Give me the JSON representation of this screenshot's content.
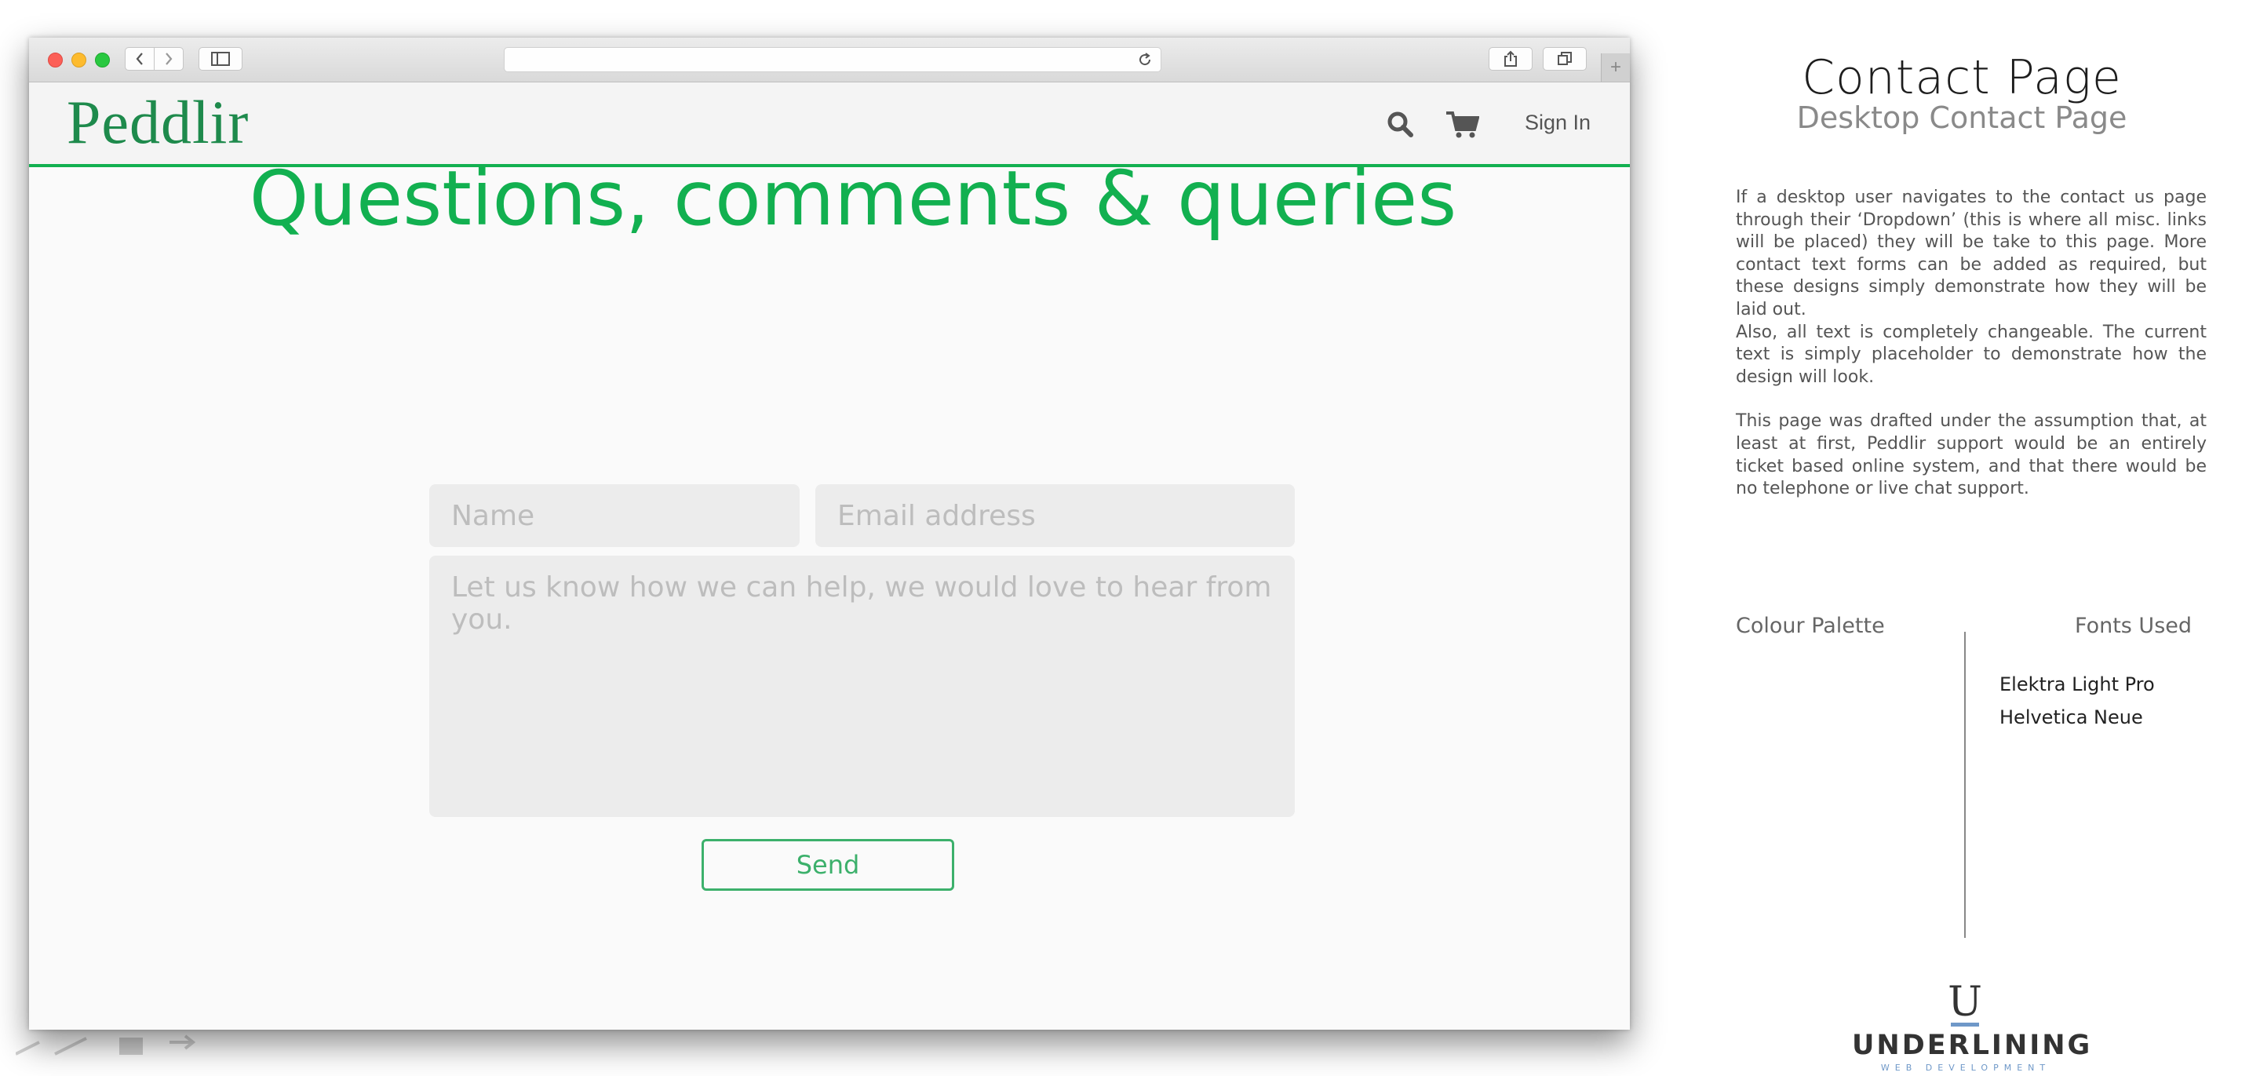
{
  "browser": {
    "nav": {
      "back_icon": "chevron-left-icon",
      "forward_icon": "chevron-right-icon"
    },
    "new_tab_label": "+"
  },
  "site": {
    "logo": "Peddlir",
    "sign_in": "Sign In",
    "brand_color": "#12b050",
    "icons": [
      "search-icon",
      "cart-icon"
    ]
  },
  "contact": {
    "headline": "Questions, comments & queries",
    "name_placeholder": "Name",
    "email_placeholder": "Email address",
    "message_placeholder": "Let us know how we can help, we would love to hear from you.",
    "send_label": "Send"
  },
  "notes": {
    "title": "Contact Page",
    "subtitle": "Desktop Contact Page",
    "paragraph_1": "If a desktop user navigates to the contact us page through their ‘Dropdown’ (this is where all misc. links will be placed) they will be take to this page.  More contact text forms can be added as required, but these designs simply demonstrate how they will be laid out.",
    "paragraph_2": "Also, all text is completely changeable.  The current text is simply placeholder to demonstrate how the design will look.",
    "paragraph_3": "This page was drafted under the assumption that, at least at first, Peddlir support would be an entirely ticket based online system, and that there would be no telephone or live chat support.",
    "colour_palette_label": "Colour Palette",
    "fonts_used_label": "Fonts Used",
    "fonts": [
      "Elektra Light Pro",
      "Helvetica Neue"
    ]
  },
  "branding": {
    "mark": "U",
    "name": "UNDERLINING",
    "tagline": "WEB DEVELOPMENT",
    "accent_color": "#6f98c8"
  }
}
